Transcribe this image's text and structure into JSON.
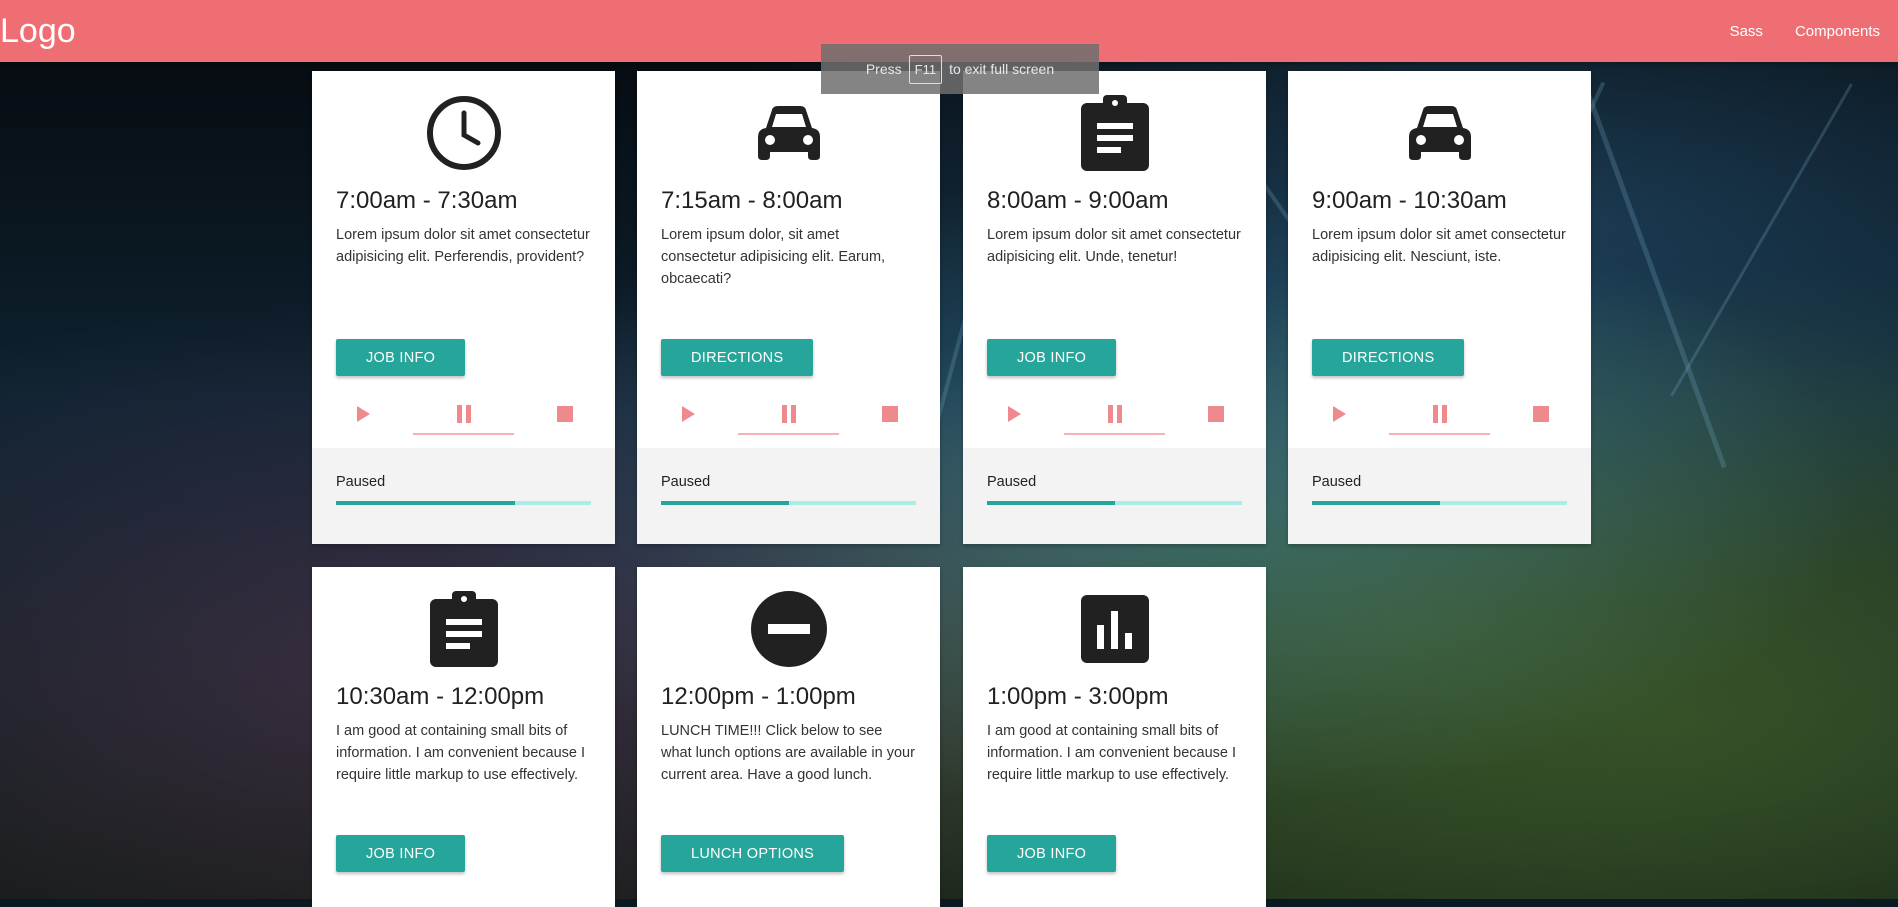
{
  "nav": {
    "logo": "Logo",
    "links": [
      "Sass",
      "Components"
    ]
  },
  "fullscreen_toast": {
    "before": "Press",
    "key": "F11",
    "after": "to exit full screen"
  },
  "cards": [
    {
      "icon": "clock-icon",
      "title": "7:00am - 7:30am",
      "desc": "Lorem ipsum dolor sit amet consectetur adipisicing elit. Perferendis, provident?",
      "button": "Job Info",
      "status": "Paused",
      "progress": 0.7
    },
    {
      "icon": "car-icon",
      "title": "7:15am - 8:00am",
      "desc": "Lorem ipsum dolor, sit amet consectetur adipisicing elit. Earum, obcaecati?",
      "button": "Directions",
      "status": "Paused",
      "progress": 0.5
    },
    {
      "icon": "clipboard-icon",
      "title": "8:00am - 9:00am",
      "desc": "Lorem ipsum dolor sit amet consectetur adipisicing elit. Unde, tenetur!",
      "button": "Job Info",
      "status": "Paused",
      "progress": 0.5
    },
    {
      "icon": "car-icon",
      "title": "9:00am - 10:30am",
      "desc": "Lorem ipsum dolor sit amet consectetur adipisicing elit. Nesciunt, iste.",
      "button": "Directions",
      "status": "Paused",
      "progress": 0.5
    },
    {
      "icon": "clipboard-icon",
      "title": "10:30am - 12:00pm",
      "desc": "I am good at containing small bits of information. I am convenient because I require little markup to use effectively.",
      "button": "Job Info"
    },
    {
      "icon": "no-entry-icon",
      "title": "12:00pm - 1:00pm",
      "desc": "LUNCH TIME!!! Click below to see what lunch options are available in your current area. Have a good lunch.",
      "button": "Lunch Options"
    },
    {
      "icon": "bar-chart-icon",
      "title": "1:00pm - 3:00pm",
      "desc": "I am good at containing small bits of information. I am convenient because I require little markup to use effectively.",
      "button": "Job Info"
    }
  ],
  "colors": {
    "nav": "#ee6e73",
    "button": "#26a69a",
    "control_icon": "#ee8a8e",
    "progress_fill": "#26a69a",
    "progress_track": "#acece6"
  }
}
